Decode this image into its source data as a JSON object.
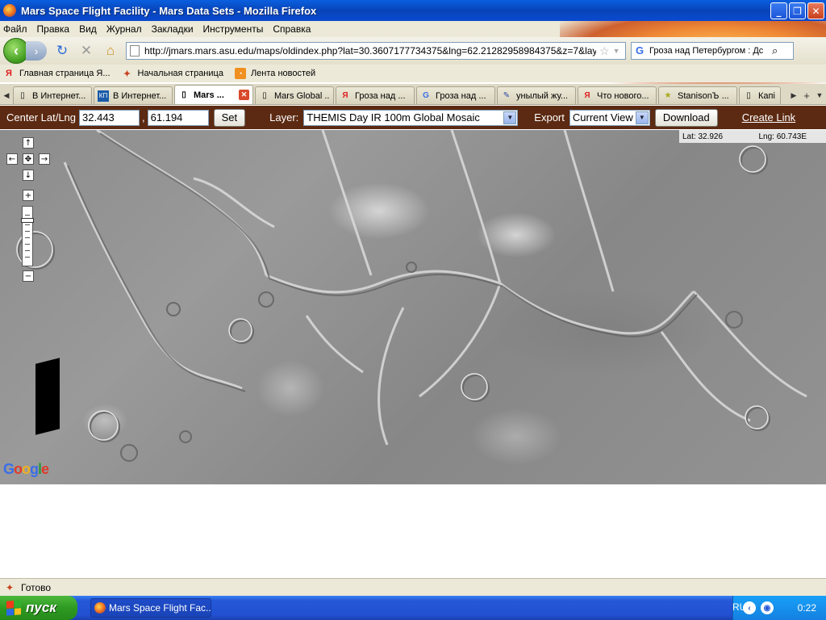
{
  "window": {
    "title": "Mars Space Flight Facility - Mars Data Sets - Mozilla Firefox",
    "minimize": "_",
    "maximize": "❐",
    "close": "✕"
  },
  "menu": [
    "Файл",
    "Правка",
    "Вид",
    "Журнал",
    "Закладки",
    "Инструменты",
    "Справка"
  ],
  "nav": {
    "url": "http://jmars.mars.asu.edu/maps/oldindex.php?lat=30.3607177734375&lng=62.21282958984375&z=7&layer=thr",
    "search_value": "Гроза над Петербургом : Дс"
  },
  "bookmarks": [
    "Главная страница Я...",
    "Начальная страница",
    "Лента новостей"
  ],
  "tabs": [
    {
      "label": "В Интернет...",
      "icon": "page-icon"
    },
    {
      "label": "В Интернет...",
      "icon": "kp-icon"
    },
    {
      "label": "Mars ...",
      "icon": "page-icon",
      "active": true
    },
    {
      "label": "Mars Global ...",
      "icon": "page-icon"
    },
    {
      "label": "Гроза над ...",
      "icon": "yandex-icon"
    },
    {
      "label": "Гроза над ...",
      "icon": "google-icon"
    },
    {
      "label": "унылый жу...",
      "icon": "pen-icon"
    },
    {
      "label": "Что нового...",
      "icon": "yandex-icon"
    },
    {
      "label": "StanisonЪ ...",
      "icon": "star-icon"
    },
    {
      "label": "Капі",
      "icon": "page-icon"
    }
  ],
  "controls": {
    "center_label": "Center Lat/Lng",
    "lat_value": "32.443",
    "comma": ",",
    "lng_value": "61.194",
    "set_label": "Set",
    "layer_label": "Layer:",
    "layer_value": "THEMIS Day IR 100m Global Mosaic",
    "export_label": "Export",
    "export_value": "Current View",
    "download_label": "Download",
    "create_link_label": "Create Link"
  },
  "map": {
    "lat_readout": "Lat: 32.926",
    "lng_readout": "Lng: 60.743E",
    "logo": "Google",
    "pan_up": "↑",
    "pan_down": "↓",
    "pan_left": "←",
    "pan_right": "→",
    "pan_center": "✥",
    "zoom_in": "+",
    "zoom_out": "−"
  },
  "status": {
    "text": "Готово"
  },
  "taskbar": {
    "start_label": "пуск",
    "item_label": "Mars Space Flight Fac...",
    "lang": "RU",
    "clock": "0:22"
  }
}
